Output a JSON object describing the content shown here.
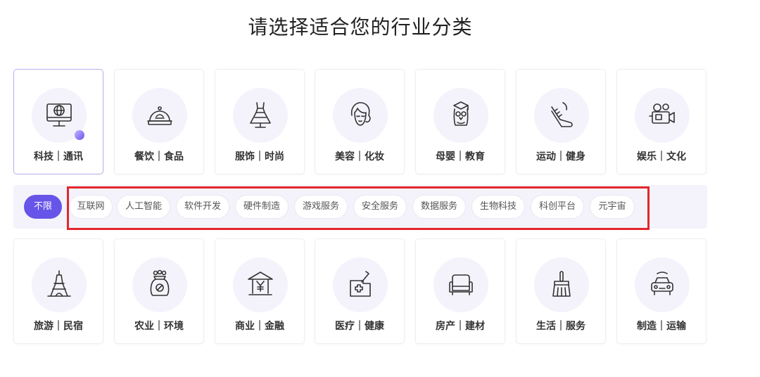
{
  "page": {
    "title": "请选择适合您的行业分类"
  },
  "categories_row1": [
    {
      "label": "科技｜通讯",
      "icon": "monitor-globe-icon",
      "selected": true
    },
    {
      "label": "餐饮｜食品",
      "icon": "food-cloche-icon"
    },
    {
      "label": "服饰｜时尚",
      "icon": "dress-icon"
    },
    {
      "label": "美容｜化妆",
      "icon": "woman-face-icon"
    },
    {
      "label": "母婴｜教育",
      "icon": "owl-graduate-icon"
    },
    {
      "label": "运动｜健身",
      "icon": "sneaker-icon"
    },
    {
      "label": "娱乐｜文化",
      "icon": "video-camera-icon"
    }
  ],
  "subcategories": {
    "all_label": "不限",
    "items": [
      "互联网",
      "人工智能",
      "软件开发",
      "硬件制造",
      "游戏服务",
      "安全服务",
      "数据服务",
      "生物科技",
      "科创平台",
      "元宇宙"
    ]
  },
  "categories_row2": [
    {
      "label": "旅游｜民宿",
      "icon": "eiffel-tower-icon"
    },
    {
      "label": "农业｜环境",
      "icon": "grain-sack-icon"
    },
    {
      "label": "商业｜金融",
      "icon": "bank-yen-icon"
    },
    {
      "label": "医疗｜健康",
      "icon": "medical-kit-icon"
    },
    {
      "label": "房产｜建材",
      "icon": "sofa-icon"
    },
    {
      "label": "生活｜服务",
      "icon": "broom-icon"
    },
    {
      "label": "制造｜运输",
      "icon": "car-icon"
    }
  ],
  "colors": {
    "accent": "#6754e8",
    "highlight_box": "#e3262d",
    "subcat_bg": "#f4f3fb"
  }
}
